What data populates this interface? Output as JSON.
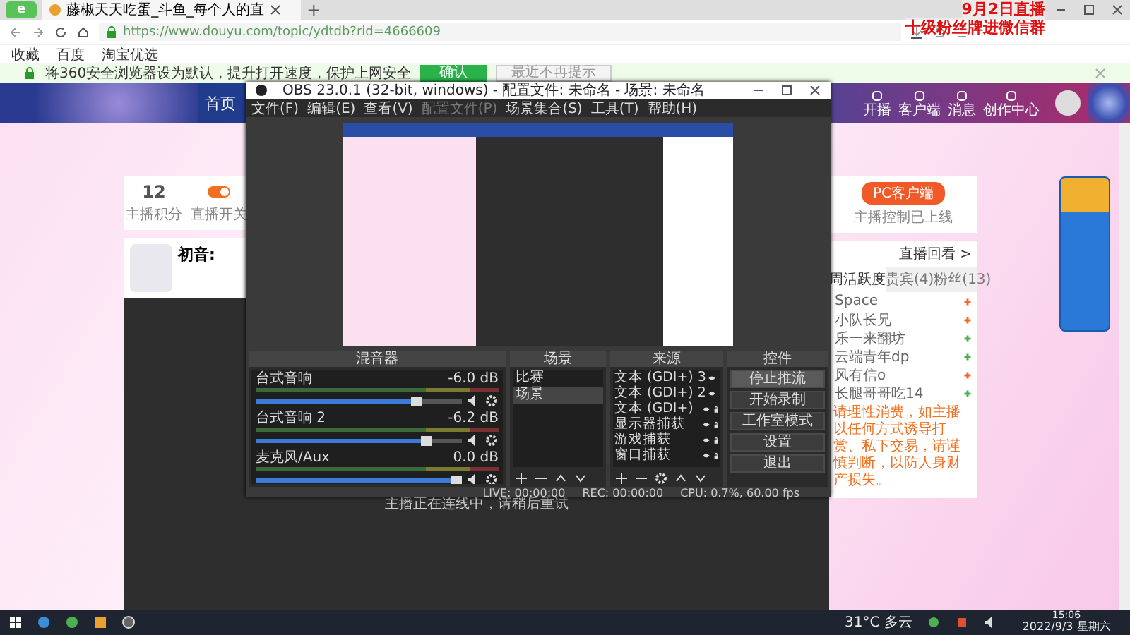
{
  "browser": {
    "logo": "e",
    "tab": {
      "title": "藤椒天天吃蛋_斗鱼_每个人的直"
    },
    "new_tab": "+",
    "url": "https://www.douyu.com/topic/ydtdb?rid=4666609",
    "bookmarks": [
      "收藏",
      "百度",
      "淘宝优选"
    ],
    "notice": {
      "text": "将360安全浏览器设为默认，提升打开速度，保护上网安全",
      "confirm": "确认",
      "dismiss": "最近不再提示"
    }
  },
  "stream_overlay": [
    "9月2日直播",
    "十级粉丝牌进微信群"
  ],
  "site": {
    "nav": [
      "首页"
    ],
    "header_actions": [
      "开播",
      "客户端",
      "消息",
      "创作中心"
    ],
    "score": {
      "value": "12",
      "label": "主播积分",
      "switch_label": "直播开关",
      "switch_on": true
    },
    "streamer": {
      "name": "初音:"
    },
    "player_message": "主播正在连线中，请稍后重试",
    "client_button": "PC客户端",
    "client_note": "主播控制已上线",
    "replay": "直播回看 >",
    "tabs": [
      {
        "label": "周活跃度",
        "selected": true
      },
      {
        "label": "贵宾(4)",
        "selected": false
      },
      {
        "label": "粉丝(13)",
        "selected": false
      }
    ],
    "members": [
      {
        "name": "Space",
        "color": "#f06a2a"
      },
      {
        "name": "小队长兄",
        "color": "#f06a2a"
      },
      {
        "name": "乐一来翻坊",
        "color": "#4caf50"
      },
      {
        "name": "云端青年dp",
        "color": "#4caf50"
      },
      {
        "name": "风有信o",
        "color": "#f06a2a"
      },
      {
        "name": "长腿哥哥吃14",
        "color": "#4caf50"
      }
    ],
    "warning": "请理性消费，如主播以任何方式诱导打赏、私下交易，请谨慎判断，以防人身财产损失。"
  },
  "obs": {
    "title": "OBS 23.0.1 (32-bit, windows) - 配置文件: 未命名 - 场景: 未命名",
    "menu": [
      {
        "label": "文件(F)",
        "disabled": false
      },
      {
        "label": "编辑(E)",
        "disabled": false
      },
      {
        "label": "查看(V)",
        "disabled": false
      },
      {
        "label": "配置文件(P)",
        "disabled": true
      },
      {
        "label": "场景集合(S)",
        "disabled": false
      },
      {
        "label": "工具(T)",
        "disabled": false
      },
      {
        "label": "帮助(H)",
        "disabled": false
      }
    ],
    "mixer": {
      "title": "混音器",
      "channels": [
        {
          "name": "台式音响",
          "reading": "-6.0 dB",
          "level": 0.78
        },
        {
          "name": "台式音响 2",
          "reading": "-6.2 dB",
          "level": 0.83
        },
        {
          "name": "麦克风/Aux",
          "reading": "0.0 dB",
          "level": 0.97
        }
      ]
    },
    "scenes": {
      "title": "场景",
      "items": [
        {
          "label": "比赛",
          "selected": false
        },
        {
          "label": "场景",
          "selected": true
        }
      ]
    },
    "sources": {
      "title": "来源",
      "items": [
        "文本 (GDI+) 3",
        "文本 (GDI+) 2",
        "文本 (GDI+)",
        "显示器捕获",
        "游戏捕获",
        "窗口捕获"
      ]
    },
    "controls": {
      "title": "控件",
      "buttons": [
        {
          "label": "停止推流",
          "active": true
        },
        {
          "label": "开始录制",
          "active": false
        },
        {
          "label": "工作室模式",
          "active": false
        },
        {
          "label": "设置",
          "active": false
        },
        {
          "label": "退出",
          "active": false
        }
      ]
    },
    "status": {
      "live": "LIVE: 00:00:00",
      "rec": "REC: 00:00:00",
      "cpu": "CPU: 0.7%, 60.00 fps"
    }
  },
  "taskbar": {
    "weather": "31°C 多云",
    "time": "15:06",
    "date": "2022/9/3 星期六"
  }
}
